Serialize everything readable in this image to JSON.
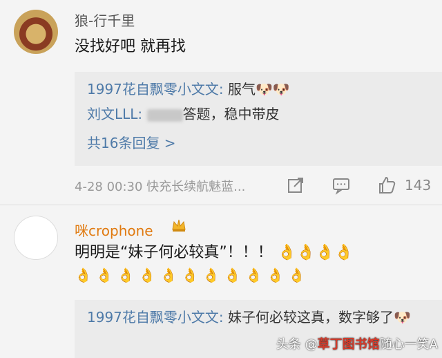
{
  "comment1": {
    "username": "狼-行千里",
    "text": "没找好吧  就再找",
    "replies": [
      {
        "user": "1997花自飘零小文文:",
        "text": " 服气🐶🐶"
      },
      {
        "user": "刘文LLL:",
        "text": "答题，稳中带皮"
      }
    ],
    "more_replies": "共16条回复 >",
    "timestamp": "4-28 00:30  快充长续航魅蓝...",
    "likes": "143"
  },
  "comment2": {
    "username": "咪crophone",
    "text": "明明是“妹子何必较真”！！！ 👌👌👌👌",
    "emoji_row": "👌👌👌👌👌👌👌👌👌👌👌",
    "replies": [
      {
        "user": "1997花自飘零小文文:",
        "text": " 妹子何必较这真，数字够了🐶"
      }
    ]
  },
  "watermark": {
    "prefix": "头条 @",
    "brand": "草丁图书馆",
    "suffix": "随心一笑A"
  }
}
